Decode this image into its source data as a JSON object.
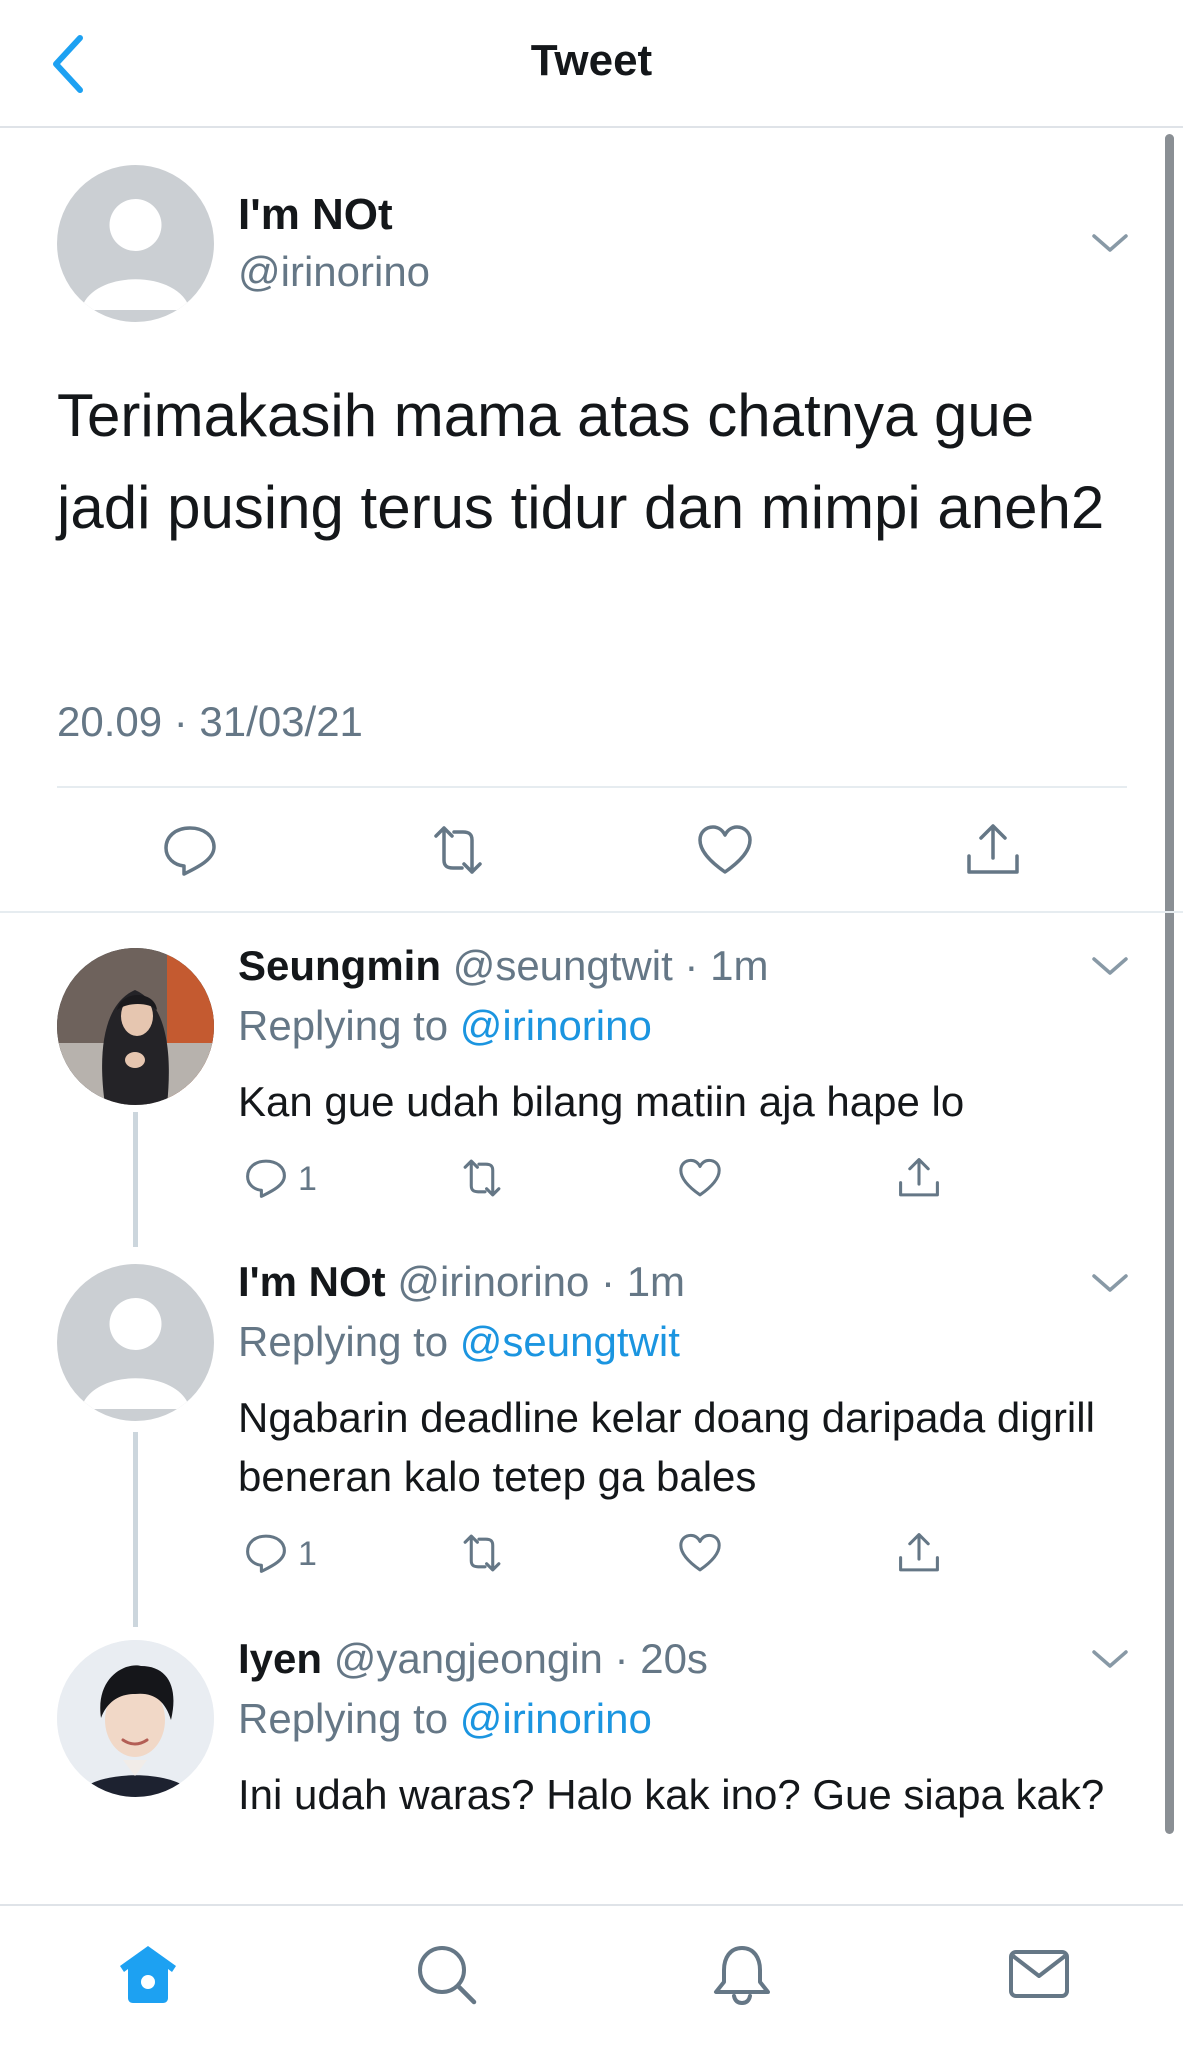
{
  "header": {
    "title": "Tweet",
    "back_icon": "chevron-left-icon"
  },
  "main_tweet": {
    "display_name": "I'm NOt",
    "handle": "@irinorino",
    "text": "Terimakasih mama atas chatnya gue jadi pusing terus tidur dan mimpi aneh2",
    "timestamp": "20.09 · 31/03/21",
    "actions": [
      "reply-icon",
      "retweet-icon",
      "like-icon",
      "share-icon"
    ]
  },
  "replies": [
    {
      "display_name": "Seungmin",
      "meta": "@seungtwit · 1m",
      "replying_prefix": "Replying to ",
      "replying_to": "@irinorino",
      "text": "Kan gue udah bilang matiin aja hape lo",
      "reply_count": "1",
      "avatar": "photo"
    },
    {
      "display_name": "I'm NOt",
      "meta": "@irinorino · 1m",
      "replying_prefix": "Replying to ",
      "replying_to": "@seungtwit",
      "text": "Ngabarin deadline kelar doang daripada digrill beneran kalo tetep ga bales",
      "reply_count": "1",
      "avatar": "default"
    },
    {
      "display_name": "Iyen",
      "meta": "@yangjeongin · 20s",
      "replying_prefix": "Replying to ",
      "replying_to": "@irinorino",
      "text": "Ini udah waras? Halo kak ino? Gue siapa kak?",
      "avatar": "photo"
    }
  ],
  "tabbar": [
    "home-icon",
    "search-icon",
    "notifications-icon",
    "messages-icon"
  ],
  "colors": {
    "accent": "#1da1f2",
    "mention": "#1b95e0",
    "secondary_text": "#657786",
    "divider": "#e6ecf0"
  }
}
